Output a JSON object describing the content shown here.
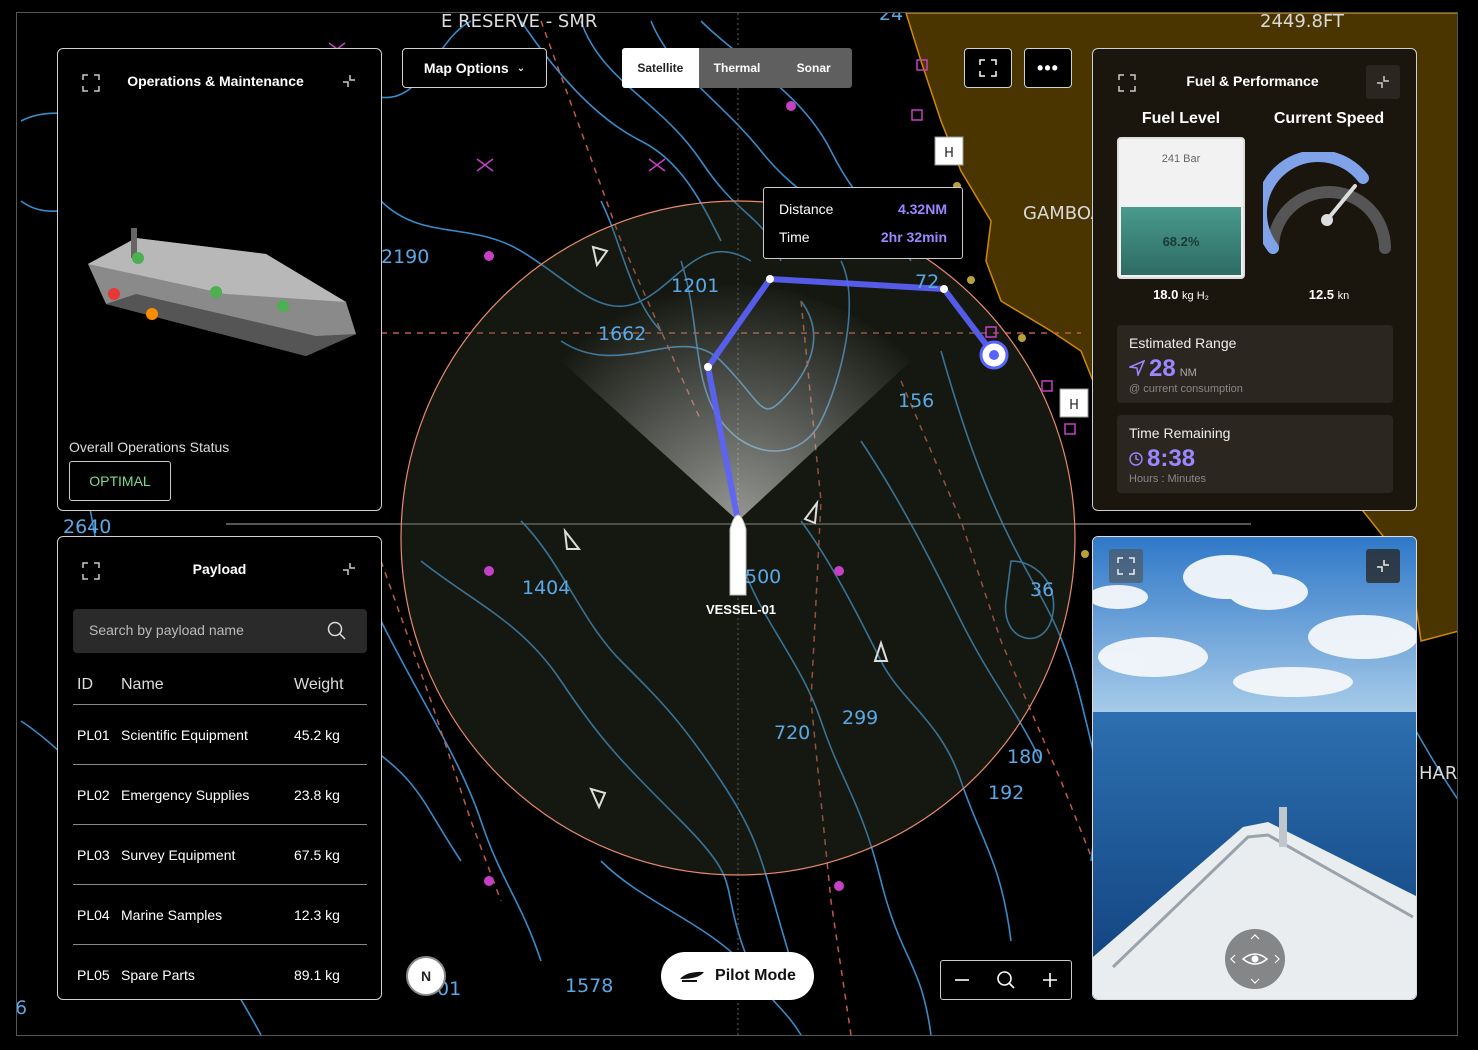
{
  "map": {
    "labels": {
      "reserve": "E RESERVE - SMR",
      "elevation_top": "2449.8FT",
      "gambo": "GAMBOA",
      "har": "HAR",
      "d24": "24",
      "d2190": "2190",
      "d1201": "1201",
      "d1662": "1662",
      "d72": "72",
      "d156": "156",
      "d2640": "2640",
      "d1404": "1404",
      "d500": "500",
      "d36": "36",
      "d299": "299",
      "d720": "720",
      "d180": "180",
      "d192": "192",
      "d1578": "1578",
      "d01": "01",
      "d6": "6"
    },
    "vessel_label": "VESSEL-01"
  },
  "toolbar": {
    "map_options": "Map Options",
    "modes": [
      "Satellite",
      "Thermal",
      "Sonar"
    ],
    "active_mode": "Satellite"
  },
  "route_tooltip": {
    "distance_label": "Distance",
    "distance_value": "4.32NM",
    "time_label": "Time",
    "time_value": "2hr 32min"
  },
  "operations": {
    "title": "Operations & Maintenance",
    "status_label": "Overall Operations Status",
    "status_value": "OPTIMAL"
  },
  "payload": {
    "title": "Payload",
    "search_placeholder": "Search by payload name",
    "columns": [
      "ID",
      "Name",
      "Weight"
    ],
    "rows": [
      {
        "id": "PL01",
        "name": "Scientific Equipment",
        "weight": "45.2 kg"
      },
      {
        "id": "PL02",
        "name": "Emergency Supplies",
        "weight": "23.8 kg"
      },
      {
        "id": "PL03",
        "name": "Survey Equipment",
        "weight": "67.5 kg"
      },
      {
        "id": "PL04",
        "name": "Marine Samples",
        "weight": "12.3 kg"
      },
      {
        "id": "PL05",
        "name": "Spare Parts",
        "weight": "89.1 kg"
      }
    ]
  },
  "fuel": {
    "title": "Fuel & Performance",
    "fuel_level_label": "Fuel Level",
    "pressure": "241 Bar",
    "fill_percent": 68.2,
    "fill_text": "68.2%",
    "fuel_amount": "18.0",
    "fuel_unit": "kg H₂",
    "speed_label": "Current Speed",
    "speed_value": "12.5",
    "speed_unit": "kn",
    "range_label": "Estimated Range",
    "range_value": "28",
    "range_unit": "NM",
    "range_note": "@ current consumption",
    "time_label": "Time Remaining",
    "time_value": "8:38",
    "time_note": "Hours : Minutes"
  },
  "pilot": {
    "label": "Pilot Mode"
  },
  "compass": {
    "label": "N"
  },
  "colors": {
    "accent": "#9b87ff",
    "route": "#5b63ff",
    "land": "#4a3400",
    "contour": "#3f9be0",
    "optimal": "#7ddc8c"
  }
}
